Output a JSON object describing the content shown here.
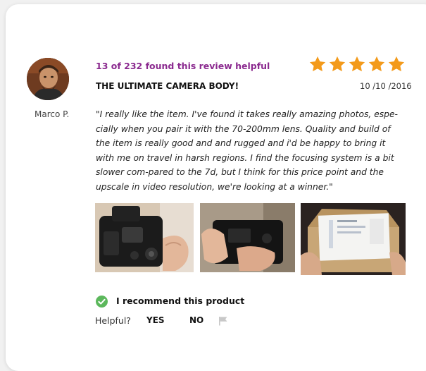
{
  "review": {
    "reviewer_name": "Marco P.",
    "helpful_count": "13 of 232 found this review helpful",
    "title": "THE ULTIMATE CAMERA BODY!",
    "date": "10 /10 /2016",
    "rating": 5,
    "rating_max": 5,
    "body": "\"I really like the item. I've found it takes really amazing photos, espe-cially when you pair it with the 70-200mm lens. Quality and build of the item is really good and and rugged and i'd be happy to bring it with me on travel in harsh regions. I find the focusing system is a bit slower com-pared to the 7d, but I think for this price point and the upscale in video resolution, we're looking at a winner.\"",
    "recommend_text": "I recommend this product",
    "helpful_label": "Helpful?",
    "yes_label": "YES",
    "no_label": "NO"
  },
  "colors": {
    "accent": "#8b2a8f",
    "star": "#f39a1b",
    "recommend": "#5cb85c",
    "flag": "#c8c8c8"
  },
  "icons": {
    "star": "star-icon",
    "check": "check-circle-icon",
    "flag": "flag-icon"
  }
}
